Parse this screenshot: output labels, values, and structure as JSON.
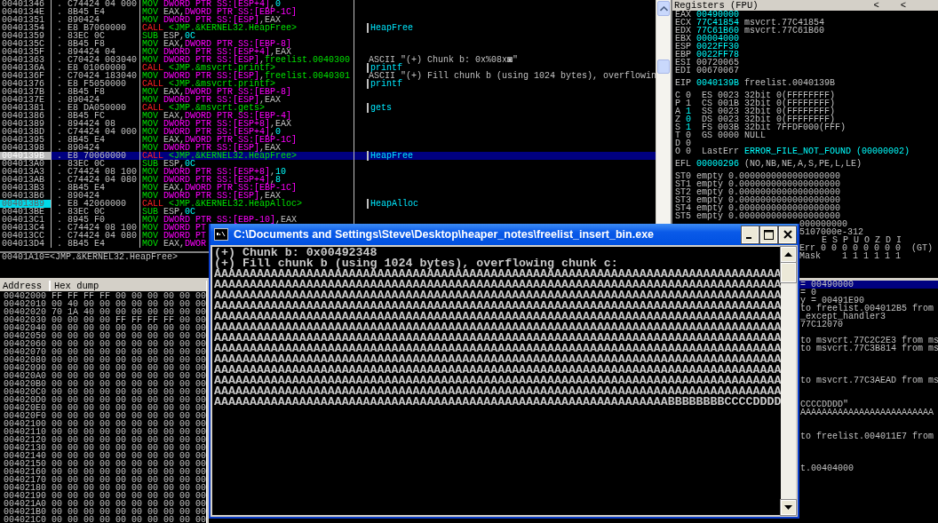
{
  "disassembly": {
    "rows": [
      {
        "address": "00401346",
        "marker": ".",
        "hex": "C74424 04 000",
        "parts": [
          {
            "text": "MOV",
            "kind": "op"
          },
          {
            "text": "DWORD PTR SS:[ESP+4]",
            "kind": "mem"
          },
          {
            "text": ",",
            "kind": "plain"
          },
          {
            "text": "0",
            "kind": "const"
          }
        ],
        "selected": false,
        "marked": false
      },
      {
        "address": "0040134E",
        "marker": ".",
        "hex": "8B45 E4",
        "parts": [
          {
            "text": "MOV",
            "kind": "op"
          },
          {
            "text": "EAX,",
            "kind": "plain"
          },
          {
            "text": "DWORD PTR SS:[EBP-1C]",
            "kind": "mem"
          }
        ],
        "selected": false,
        "marked": false
      },
      {
        "address": "00401351",
        "marker": ".",
        "hex": "890424",
        "parts": [
          {
            "text": "MOV",
            "kind": "op"
          },
          {
            "text": "DWORD PTR SS:[ESP]",
            "kind": "mem"
          },
          {
            "text": ",EAX",
            "kind": "plain"
          }
        ],
        "selected": false,
        "marked": false
      },
      {
        "address": "00401354",
        "marker": ".",
        "hex": "E8 B7060000",
        "parts": [
          {
            "text": "CALL",
            "kind": "call"
          },
          {
            "text": "<JMP.&KERNEL32.HeapFree>",
            "kind": "target"
          }
        ],
        "comment": {
          "text": "HeapFree",
          "kind": "call"
        },
        "selected": false,
        "marked": false
      },
      {
        "address": "00401359",
        "marker": ".",
        "hex": "83EC 0C",
        "parts": [
          {
            "text": "SUB",
            "kind": "op"
          },
          {
            "text": "ESP,",
            "kind": "plain"
          },
          {
            "text": "0C",
            "kind": "const"
          }
        ],
        "selected": false,
        "marked": false
      },
      {
        "address": "0040135C",
        "marker": ".",
        "hex": "8B45 F8",
        "parts": [
          {
            "text": "MOV",
            "kind": "op"
          },
          {
            "text": "EAX,",
            "kind": "plain"
          },
          {
            "text": "DWORD PTR SS:[EBP-8]",
            "kind": "mem"
          }
        ],
        "selected": false,
        "marked": false
      },
      {
        "address": "0040135F",
        "marker": ".",
        "hex": "894424 04",
        "parts": [
          {
            "text": "MOV",
            "kind": "op"
          },
          {
            "text": "DWORD PTR SS:[ESP+4]",
            "kind": "mem"
          },
          {
            "text": ",EAX",
            "kind": "plain"
          }
        ],
        "selected": false,
        "marked": false
      },
      {
        "address": "00401363",
        "marker": ".",
        "hex": "C70424 003040",
        "parts": [
          {
            "text": "MOV",
            "kind": "op"
          },
          {
            "text": "DWORD PTR SS:[ESP]",
            "kind": "mem"
          },
          {
            "text": ",",
            "kind": "plain"
          },
          {
            "text": "freelist.0040300",
            "kind": "target"
          }
        ],
        "comment": {
          "text": "ASCII \"(+) Chunk b: 0x%08x◙\"",
          "kind": "ascii"
        },
        "selected": false,
        "marked": false
      },
      {
        "address": "0040136A",
        "marker": ".",
        "hex": "E8 01060000",
        "parts": [
          {
            "text": "CALL",
            "kind": "call"
          },
          {
            "text": "<JMP.&msvcrt.printf>",
            "kind": "target"
          }
        ],
        "comment": {
          "text": "printf",
          "kind": "call"
        },
        "selected": false,
        "marked": false
      },
      {
        "address": "0040136F",
        "marker": ".",
        "hex": "C70424 183040",
        "parts": [
          {
            "text": "MOV",
            "kind": "op"
          },
          {
            "text": "DWORD PTR SS:[ESP]",
            "kind": "mem"
          },
          {
            "text": ",",
            "kind": "plain"
          },
          {
            "text": "freelist.0040301",
            "kind": "target"
          }
        ],
        "comment": {
          "text": "ASCII \"(+) Fill chunk b (using 1024 bytes), overflowin",
          "kind": "ascii"
        },
        "selected": false,
        "marked": false
      },
      {
        "address": "00401376",
        "marker": ".",
        "hex": "E8 F5050000",
        "parts": [
          {
            "text": "CALL",
            "kind": "call"
          },
          {
            "text": "<JMP.&msvcrt.printf>",
            "kind": "target"
          }
        ],
        "comment": {
          "text": "printf",
          "kind": "call"
        },
        "selected": false,
        "marked": false
      },
      {
        "address": "0040137B",
        "marker": ".",
        "hex": "8B45 F8",
        "parts": [
          {
            "text": "MOV",
            "kind": "op"
          },
          {
            "text": "EAX,",
            "kind": "plain"
          },
          {
            "text": "DWORD PTR SS:[EBP-8]",
            "kind": "mem"
          }
        ],
        "selected": false,
        "marked": false
      },
      {
        "address": "0040137E",
        "marker": ".",
        "hex": "890424",
        "parts": [
          {
            "text": "MOV",
            "kind": "op"
          },
          {
            "text": "DWORD PTR SS:[ESP]",
            "kind": "mem"
          },
          {
            "text": ",EAX",
            "kind": "plain"
          }
        ],
        "selected": false,
        "marked": false
      },
      {
        "address": "00401381",
        "marker": ".",
        "hex": "E8 DA050000",
        "parts": [
          {
            "text": "CALL",
            "kind": "call"
          },
          {
            "text": "<JMP.&msvcrt.gets>",
            "kind": "target"
          }
        ],
        "comment": {
          "text": "gets",
          "kind": "call"
        },
        "selected": false,
        "marked": false
      },
      {
        "address": "00401386",
        "marker": ".",
        "hex": "8B45 FC",
        "parts": [
          {
            "text": "MOV",
            "kind": "op"
          },
          {
            "text": "EAX,",
            "kind": "plain"
          },
          {
            "text": "DWORD PTR SS:[EBP-4]",
            "kind": "mem"
          }
        ],
        "selected": false,
        "marked": false
      },
      {
        "address": "00401389",
        "marker": ".",
        "hex": "894424 08",
        "parts": [
          {
            "text": "MOV",
            "kind": "op"
          },
          {
            "text": "DWORD PTR SS:[ESP+8]",
            "kind": "mem"
          },
          {
            "text": ",EAX",
            "kind": "plain"
          }
        ],
        "selected": false,
        "marked": false
      },
      {
        "address": "0040138D",
        "marker": ".",
        "hex": "C74424 04 000",
        "parts": [
          {
            "text": "MOV",
            "kind": "op"
          },
          {
            "text": "DWORD PTR SS:[ESP+4]",
            "kind": "mem"
          },
          {
            "text": ",",
            "kind": "plain"
          },
          {
            "text": "0",
            "kind": "const"
          }
        ],
        "selected": false,
        "marked": false
      },
      {
        "address": "00401395",
        "marker": ".",
        "hex": "8B45 E4",
        "parts": [
          {
            "text": "MOV",
            "kind": "op"
          },
          {
            "text": "EAX,",
            "kind": "plain"
          },
          {
            "text": "DWORD PTR SS:[EBP-1C]",
            "kind": "mem"
          }
        ],
        "selected": false,
        "marked": false
      },
      {
        "address": "00401398",
        "marker": ".",
        "hex": "890424",
        "parts": [
          {
            "text": "MOV",
            "kind": "op"
          },
          {
            "text": "DWORD PTR SS:[ESP]",
            "kind": "mem"
          },
          {
            "text": ",EAX",
            "kind": "plain"
          }
        ],
        "selected": false,
        "marked": false
      },
      {
        "address": "0040139B",
        "marker": ".",
        "hex": "E8 70060000",
        "parts": [
          {
            "text": "CALL",
            "kind": "call"
          },
          {
            "text": "<JMP.&KERNEL32.HeapFree>",
            "kind": "target"
          }
        ],
        "comment": {
          "text": "HeapFree",
          "kind": "call"
        },
        "selected": true,
        "marked": false
      },
      {
        "address": "004013A0",
        "marker": ".",
        "hex": "83EC 0C",
        "parts": [
          {
            "text": "SUB",
            "kind": "op"
          },
          {
            "text": "ESP,",
            "kind": "plain"
          },
          {
            "text": "0C",
            "kind": "const"
          }
        ],
        "selected": false,
        "marked": false
      },
      {
        "address": "004013A3",
        "marker": ".",
        "hex": "C74424 08 100",
        "parts": [
          {
            "text": "MOV",
            "kind": "op"
          },
          {
            "text": "DWORD PTR SS:[ESP+8]",
            "kind": "mem"
          },
          {
            "text": ",",
            "kind": "plain"
          },
          {
            "text": "10",
            "kind": "const"
          }
        ],
        "selected": false,
        "marked": false
      },
      {
        "address": "004013AB",
        "marker": ".",
        "hex": "C74424 04 080",
        "parts": [
          {
            "text": "MOV",
            "kind": "op"
          },
          {
            "text": "DWORD PTR SS:[ESP+4]",
            "kind": "mem"
          },
          {
            "text": ",",
            "kind": "plain"
          },
          {
            "text": "8",
            "kind": "const"
          }
        ],
        "selected": false,
        "marked": false
      },
      {
        "address": "004013B3",
        "marker": ".",
        "hex": "8B45 E4",
        "parts": [
          {
            "text": "MOV",
            "kind": "op"
          },
          {
            "text": "EAX,",
            "kind": "plain"
          },
          {
            "text": "DWORD PTR SS:[EBP-1C]",
            "kind": "mem"
          }
        ],
        "selected": false,
        "marked": false
      },
      {
        "address": "004013B6",
        "marker": ".",
        "hex": "890424",
        "parts": [
          {
            "text": "MOV",
            "kind": "op"
          },
          {
            "text": "DWORD PTR SS:[ESP]",
            "kind": "mem"
          },
          {
            "text": ",EAX",
            "kind": "plain"
          }
        ],
        "selected": false,
        "marked": false
      },
      {
        "address": "004013B9",
        "marker": ".",
        "hex": "E8 42060000",
        "parts": [
          {
            "text": "CALL",
            "kind": "call"
          },
          {
            "text": "<JMP.&KERNEL32.HeapAlloc>",
            "kind": "target"
          }
        ],
        "comment": {
          "text": "HeapAlloc",
          "kind": "call"
        },
        "selected": false,
        "marked": true
      },
      {
        "address": "004013BE",
        "marker": ".",
        "hex": "83EC 0C",
        "parts": [
          {
            "text": "SUB",
            "kind": "op"
          },
          {
            "text": "ESP,",
            "kind": "plain"
          },
          {
            "text": "0C",
            "kind": "const"
          }
        ],
        "selected": false,
        "marked": false
      },
      {
        "address": "004013C1",
        "marker": ".",
        "hex": "8945 F0",
        "parts": [
          {
            "text": "MOV",
            "kind": "op"
          },
          {
            "text": "DWORD PTR SS:[EBP-10]",
            "kind": "mem"
          },
          {
            "text": ",EAX",
            "kind": "plain"
          }
        ],
        "selected": false,
        "marked": false
      },
      {
        "address": "004013C4",
        "marker": ".",
        "hex": "C74424 08 100",
        "parts": [
          {
            "text": "MOV",
            "kind": "op"
          },
          {
            "text": "DWORD PT",
            "kind": "mem"
          }
        ],
        "selected": false,
        "marked": false
      },
      {
        "address": "004013CC",
        "marker": ".",
        "hex": "C74424 04 080",
        "parts": [
          {
            "text": "MOV",
            "kind": "op"
          },
          {
            "text": "DWORD PT",
            "kind": "mem"
          }
        ],
        "selected": false,
        "marked": false
      },
      {
        "address": "004013D4",
        "marker": ".",
        "hex": "8B45 E4",
        "parts": [
          {
            "text": "MOV",
            "kind": "op"
          },
          {
            "text": "EAX,",
            "kind": "plain"
          },
          {
            "text": "DWOR",
            "kind": "mem"
          }
        ],
        "selected": false,
        "marked": false
      }
    ]
  },
  "info_line": "00401A10=<JMP.&KERNEL32.HeapFree>",
  "registers": {
    "title": "Registers (FPU)",
    "header_arrows": [
      "<",
      "<"
    ],
    "general": [
      {
        "name": "EAX",
        "value": "00490000",
        "changed": true
      },
      {
        "name": "ECX",
        "value": "77C41854",
        "changed": true,
        "comment": "msvcrt.77C41854"
      },
      {
        "name": "EDX",
        "value": "77C61B60",
        "changed": true,
        "comment": "msvcrt.77C61B60"
      },
      {
        "name": "EBX",
        "value": "00004000",
        "changed": true
      },
      {
        "name": "ESP",
        "value": "0022FF30",
        "changed": true
      },
      {
        "name": "EBP",
        "value": "0022FF78",
        "changed": true
      },
      {
        "name": "ESI",
        "value": "00720065",
        "changed": false
      },
      {
        "name": "EDI",
        "value": "00670067",
        "changed": false
      }
    ],
    "eip": {
      "name": "EIP",
      "value": "0040139B",
      "changed": true,
      "comment": "freelist.0040139B"
    },
    "flags": [
      {
        "name": "C",
        "value": "0",
        "changed": false,
        "segment": "ES 0023 32bit 0(FFFFFFFF)"
      },
      {
        "name": "P",
        "value": "1",
        "changed": false,
        "segment": "CS 001B 32bit 0(FFFFFFFF)"
      },
      {
        "name": "A",
        "value": "1",
        "changed": true,
        "segment": "SS 0023 32bit 0(FFFFFFFF)"
      },
      {
        "name": "Z",
        "value": "0",
        "changed": true,
        "segment": "DS 0023 32bit 0(FFFFFFFF)"
      },
      {
        "name": "S",
        "value": "1",
        "changed": true,
        "segment": "FS 003B 32bit 7FFDF000(FFF)"
      },
      {
        "name": "T",
        "value": "0",
        "changed": false,
        "segment": "GS 0000 NULL"
      },
      {
        "name": "D",
        "value": "0",
        "changed": false
      },
      {
        "name": "O",
        "value": "0",
        "changed": false,
        "last_error": {
          "label": "LastErr",
          "value": "ERROR_FILE_NOT_FOUND (00000002)"
        }
      }
    ],
    "efl": {
      "name": "EFL",
      "value": "00000296",
      "changed": true,
      "decoded": "(NO,NB,NE,A,S,PE,L,LE)"
    },
    "fpu": [
      {
        "name": "ST0",
        "tag": "empty",
        "value": "0.0000000000000000000"
      },
      {
        "name": "ST1",
        "tag": "empty",
        "value": "0.0000000000000000000"
      },
      {
        "name": "ST2",
        "tag": "empty",
        "value": "0.0000000000000000000"
      },
      {
        "name": "ST3",
        "tag": "empty",
        "value": "0.0000000000000000000"
      },
      {
        "name": "ST4",
        "tag": "empty",
        "value": "0.0000000000000000000"
      },
      {
        "name": "ST5",
        "tag": "empty",
        "value": "0.0000000000000000000"
      }
    ],
    "fpu_tail": [
      {
        "text": "000000000",
        "kind": "value"
      },
      {
        "text": "5107000e-312",
        "kind": "value"
      },
      {
        "text": "E S P U O Z D I",
        "kind": "header"
      },
      {
        "text": "Err 0 0 0 0 0 0 0 0  (GT)",
        "kind": "row"
      },
      {
        "text": "Mask    1 1 1 1 1 1",
        "kind": "row"
      }
    ]
  },
  "dump": {
    "columns": [
      "Address",
      "Hex dump"
    ],
    "rows": [
      {
        "address": "00402000",
        "hex": "FF FF FF FF 00 00 00 00 00 00"
      },
      {
        "address": "00402010",
        "hex": "00 40 00 00 00 00 00 00 00 00"
      },
      {
        "address": "00402020",
        "hex": "70 1A 40 00 00 00 00 00 00 00"
      },
      {
        "address": "00402030",
        "hex": "00 00 00 00 FF FF FF FF 00 00"
      },
      {
        "address": "00402040",
        "hex": "00 00 00 00 00 00 00 00 00 00"
      },
      {
        "address": "00402050",
        "hex": "00 00 00 00 00 00 00 00 00 00"
      },
      {
        "address": "00402060",
        "hex": "00 00 00 00 00 00 00 00 00 00"
      },
      {
        "address": "00402070",
        "hex": "00 00 00 00 00 00 00 00 00 00"
      },
      {
        "address": "00402080",
        "hex": "00 00 00 00 00 00 00 00 00 00"
      },
      {
        "address": "00402090",
        "hex": "00 00 00 00 00 00 00 00 00 00"
      },
      {
        "address": "004020A0",
        "hex": "00 00 00 00 00 00 00 00 00 00"
      },
      {
        "address": "004020B0",
        "hex": "00 00 00 00 00 00 00 00 00 00"
      },
      {
        "address": "004020C0",
        "hex": "00 00 00 00 00 00 00 00 00 00"
      },
      {
        "address": "004020D0",
        "hex": "00 00 00 00 00 00 00 00 00 00"
      },
      {
        "address": "004020E0",
        "hex": "00 00 00 00 00 00 00 00 00 00"
      },
      {
        "address": "004020F0",
        "hex": "00 00 00 00 00 00 00 00 00 00"
      },
      {
        "address": "00402100",
        "hex": "00 00 00 00 00 00 00 00 00 00"
      },
      {
        "address": "00402110",
        "hex": "00 00 00 00 00 00 00 00 00 00"
      },
      {
        "address": "00402120",
        "hex": "00 00 00 00 00 00 00 00 00 00"
      },
      {
        "address": "00402130",
        "hex": "00 00 00 00 00 00 00 00 00 00"
      },
      {
        "address": "00402140",
        "hex": "00 00 00 00 00 00 00 00 00 00"
      },
      {
        "address": "00402150",
        "hex": "00 00 00 00 00 00 00 00 00 00"
      },
      {
        "address": "00402160",
        "hex": "00 00 00 00 00 00 00 00 00 00"
      },
      {
        "address": "00402170",
        "hex": "00 00 00 00 00 00 00 00 00 00"
      },
      {
        "address": "00402180",
        "hex": "00 00 00 00 00 00 00 00 00 00"
      },
      {
        "address": "00402190",
        "hex": "00 00 00 00 00 00 00 00 00 00"
      },
      {
        "address": "004021A0",
        "hex": "00 00 00 00 00 00 00 00 00 00"
      },
      {
        "address": "004021B0",
        "hex": "00 00 00 00 00 00 00 00 00 00"
      },
      {
        "address": "004021C0",
        "hex": "00 00 00 00 00 00 00 00 00 00"
      }
    ]
  },
  "stack": {
    "rows": [
      {
        "comment": "= 00490000",
        "selected": true
      },
      {
        "comment": "= 0",
        "selected": false
      },
      {
        "comment": "y = 00491E90",
        "selected": false
      },
      {
        "comment": "to freelist.004012B5 from",
        "selected": false
      },
      {
        "comment": "_except_handler3",
        "selected": false
      },
      {
        "comment": "77C12070",
        "selected": false
      },
      {
        "selected": false
      },
      {
        "comment": "to msvcrt.77C2C2E3 from ms",
        "selected": false
      },
      {
        "comment": "to msvcrt.77C3B814 from ms",
        "selected": false
      },
      {
        "selected": false
      },
      {
        "selected": false
      },
      {
        "selected": false
      },
      {
        "comment": "to msvcrt.77C3AEAD from ms",
        "selected": false
      },
      {
        "selected": false
      },
      {
        "selected": false
      },
      {
        "comment": "CCCCDDDD\"",
        "selected": false
      },
      {
        "comment": "AAAAAAAAAAAAAAAAAAAAAAAAA",
        "selected": false
      },
      {
        "selected": false
      },
      {
        "selected": false
      },
      {
        "comment": "to freelist.004011E7 from",
        "selected": false
      },
      {
        "selected": false
      },
      {
        "selected": false
      },
      {
        "selected": false
      },
      {
        "comment": "t.00404000",
        "selected": false
      }
    ]
  },
  "console": {
    "title": "C:\\Documents and Settings\\Steve\\Desktop\\heaper_notes\\freelist_insert_bin.exe",
    "lines": [
      "(+) Chunk b: 0x00492348",
      "(+) Fill chunk b (using 1024 bytes), overflowing chunk c:",
      "AAAAAAAAAAAAAAAAAAAAAAAAAAAAAAAAAAAAAAAAAAAAAAAAAAAAAAAAAAAAAAAAAAAAAAAAAAAAAAAA",
      "AAAAAAAAAAAAAAAAAAAAAAAAAAAAAAAAAAAAAAAAAAAAAAAAAAAAAAAAAAAAAAAAAAAAAAAAAAAAAAAA",
      "AAAAAAAAAAAAAAAAAAAAAAAAAAAAAAAAAAAAAAAAAAAAAAAAAAAAAAAAAAAAAAAAAAAAAAAAAAAAAAAA",
      "AAAAAAAAAAAAAAAAAAAAAAAAAAAAAAAAAAAAAAAAAAAAAAAAAAAAAAAAAAAAAAAAAAAAAAAAAAAAAAAA",
      "AAAAAAAAAAAAAAAAAAAAAAAAAAAAAAAAAAAAAAAAAAAAAAAAAAAAAAAAAAAAAAAAAAAAAAAAAAAAAAAA",
      "AAAAAAAAAAAAAAAAAAAAAAAAAAAAAAAAAAAAAAAAAAAAAAAAAAAAAAAAAAAAAAAAAAAAAAAAAAAAAAAA",
      "AAAAAAAAAAAAAAAAAAAAAAAAAAAAAAAAAAAAAAAAAAAAAAAAAAAAAAAAAAAAAAAAAAAAAAAAAAAAAAAA",
      "AAAAAAAAAAAAAAAAAAAAAAAAAAAAAAAAAAAAAAAAAAAAAAAAAAAAAAAAAAAAAAAAAAAAAAAAAAAAAAAA",
      "AAAAAAAAAAAAAAAAAAAAAAAAAAAAAAAAAAAAAAAAAAAAAAAAAAAAAAAAAAAAAAAAAAAAAAAAAAAAAAAA",
      "AAAAAAAAAAAAAAAAAAAAAAAAAAAAAAAAAAAAAAAAAAAAAAAAAAAAAAAAAAAAAAAAAAAAAAAAAAAAAAAA",
      "AAAAAAAAAAAAAAAAAAAAAAAAAAAAAAAAAAAAAAAAAAAAAAAAAAAAAAAAAAAAAAAAAAAAAAAAAAAAAAAA",
      "AAAAAAAAAAAAAAAAAAAAAAAAAAAAAAAAAAAAAAAAAAAAAAAAAAAAAAAAAAAAAAAAAAAAAAAAAAAAAAAA",
      "AAAAAAAAAAAAAAAAAAAAAAAAAAAAAAAAAAAAAAAAAAAAAAAAAAAAAAAAAAAAAAAABBBBBBBBCCCCDDDD"
    ]
  }
}
